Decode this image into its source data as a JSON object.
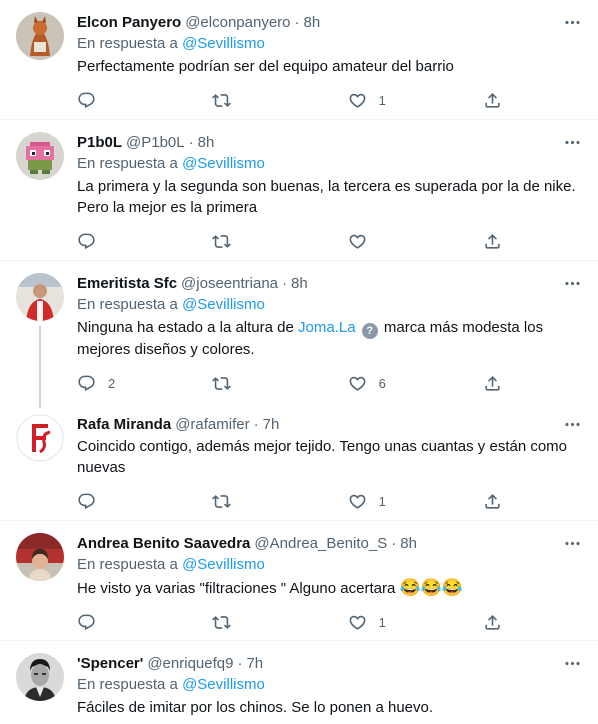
{
  "reply_prefix": "En respuesta a",
  "tweets": [
    {
      "name": "Elcon Panyero",
      "handle": "@elconpanyero",
      "time": "8h",
      "reply_to": "@Sevillismo",
      "text": "Perfectamente podrían ser del equipo amateur del barrio",
      "replies": "",
      "retweets": "",
      "likes": "1"
    },
    {
      "name": "P1b0L",
      "handle": "@P1b0L",
      "time": "8h",
      "reply_to": "@Sevillismo",
      "text": "La primera y la segunda son buenas, la tercera es superada por la de nike. Pero la mejor es la primera",
      "replies": "",
      "retweets": "",
      "likes": ""
    },
    {
      "name": "Emeritista Sfc",
      "handle": "@joseentriana",
      "time": "8h",
      "reply_to": "@Sevillismo",
      "text_before": "Ninguna ha estado a la altura de ",
      "link": "Joma.La",
      "badge": "?",
      "text_after": " marca más modesta los mejores diseños y colores.",
      "replies": "2",
      "retweets": "",
      "likes": "6"
    },
    {
      "name": "Rafa Miranda",
      "handle": "@rafamifer",
      "time": "7h",
      "text": "Coincido contigo, además mejor tejido. Tengo unas cuantas y están como nuevas",
      "replies": "",
      "retweets": "",
      "likes": "1"
    },
    {
      "name": "Andrea Benito Saavedra",
      "handle": "@Andrea_Benito_S",
      "time": "8h",
      "reply_to": "@Sevillismo",
      "text": "He visto ya varias \"filtraciones \" Alguno acertara",
      "emojis": "😂😂😂",
      "replies": "",
      "retweets": "",
      "likes": "1"
    },
    {
      "name": "'Spencer'",
      "handle": "@enriquefq9",
      "time": "7h",
      "reply_to": "@Sevillismo",
      "text": "Fáciles de imitar por los chinos. Se lo ponen a huevo."
    }
  ],
  "dot": "·",
  "icons": {
    "reply": "reply-icon",
    "retweet": "retweet-icon",
    "like": "heart-icon",
    "share": "share-icon",
    "more": "more-icon"
  },
  "colors": {
    "link": "#1d9bf0",
    "secondary": "#536471",
    "divider": "#eff3f4",
    "thread_line": "#cfd9de"
  }
}
